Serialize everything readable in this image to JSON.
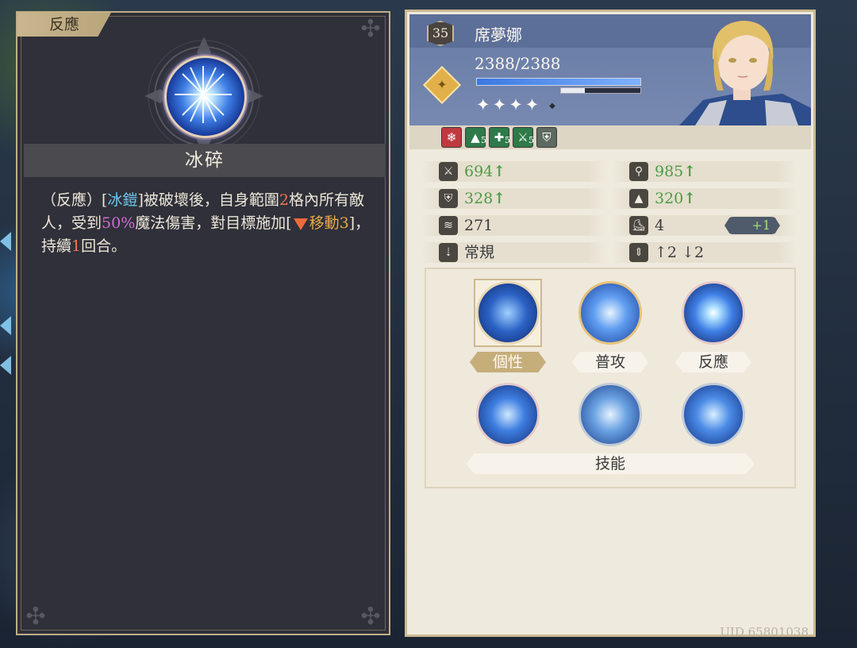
{
  "skill_detail": {
    "category_tag": "反應",
    "skill_name": "冰碎",
    "description": {
      "p1": "（反應）[",
      "ice_armor": "冰鎧",
      "p2": "]被破壞後，自身範圍",
      "range": "2",
      "p3": "格內所有敵人，受到",
      "damage_pct": "50%",
      "p4": "魔法傷害，對目標施加[",
      "debuff_name": "移動3",
      "p5": "]，持續",
      "duration": "1",
      "p6": "回合。"
    }
  },
  "character": {
    "level": "35",
    "name": "席夢娜",
    "hp_text": "2388/2388",
    "hp_fraction": 1.0,
    "exp_fraction": 0.3,
    "stars_filled": "✦✦✦✦",
    "stars_empty": "◆"
  },
  "buffs": [
    {
      "icon": "snowflake-icon",
      "glyph": "❄",
      "count": ""
    },
    {
      "icon": "boot-up-icon",
      "glyph": "▲",
      "count": "5"
    },
    {
      "icon": "cross-up-icon",
      "glyph": "✚",
      "count": "5"
    },
    {
      "icon": "sword-up-icon",
      "glyph": "⚔",
      "count": "5"
    },
    {
      "icon": "shield-icon",
      "glyph": "⛨",
      "count": ""
    }
  ],
  "stats": {
    "attack": "694",
    "magic_attack": "985",
    "defense": "328",
    "magic_defense": "320",
    "technique": "271",
    "movement": "4",
    "movement_bonus": "+1",
    "move_type": "常規",
    "height_up": "2",
    "height_down": "2"
  },
  "skills": {
    "trait_label": "個性",
    "normal_attack_label": "普攻",
    "reaction_label": "反應",
    "skills_label": "技能"
  },
  "uid": "UID 65801038"
}
